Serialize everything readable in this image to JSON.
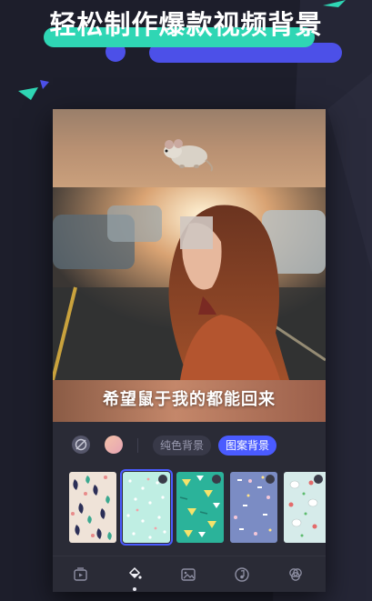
{
  "headline": "轻松制作爆款视频背景",
  "colors": {
    "accent_teal": "#2fd6b4",
    "accent_blue": "#4c50e8",
    "selected_tab": "#4a5bff"
  },
  "preview": {
    "top_sticker_icon": "mouse-icon",
    "caption": "希望鼠于我的都能回来"
  },
  "background_panel": {
    "options": [
      {
        "icon": "none-icon"
      },
      {
        "icon": "gradient-swatch"
      }
    ],
    "tabs": [
      {
        "label": "纯色背景",
        "active": false
      },
      {
        "label": "图案背景",
        "active": true
      }
    ],
    "thumbnails": [
      {
        "pattern": "leaves",
        "selected": false
      },
      {
        "pattern": "dots",
        "selected": true
      },
      {
        "pattern": "triangles",
        "selected": false
      },
      {
        "pattern": "confetti",
        "selected": false
      },
      {
        "pattern": "bunnies",
        "selected": false
      }
    ]
  },
  "bottom_bar": {
    "items": [
      {
        "icon": "video-icon",
        "active": false
      },
      {
        "icon": "paint-bucket-icon",
        "active": true
      },
      {
        "icon": "image-icon",
        "active": false
      },
      {
        "icon": "music-icon",
        "active": false
      },
      {
        "icon": "filter-icon",
        "active": false
      }
    ]
  }
}
